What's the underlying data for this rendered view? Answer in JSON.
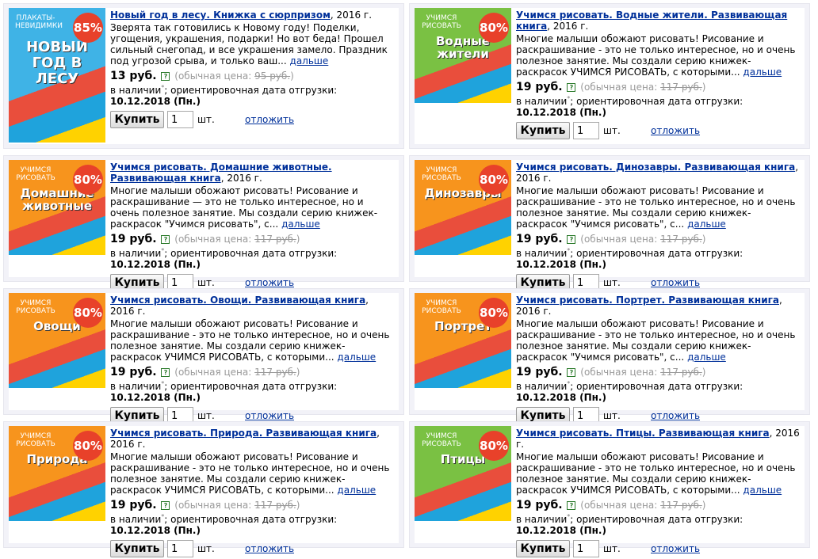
{
  "common": {
    "old_price_label": "(обычная цена:",
    "old_price_close": ")",
    "in_stock": "в наличии",
    "ship_label": "; ориентировочная дата отгрузки:",
    "ship_date": "10.12.2018 (Пн.)",
    "buy_label": "Купить",
    "qty_value": "1",
    "pcs_label": "шт.",
    "defer_label": "отложить",
    "more_label": "дальше",
    "year": ", 2016 г.",
    "help_glyph": "?"
  },
  "products": [
    {
      "title": "Новый год в лесу. Книжка с сюрпризом",
      "desc": "Зверята так готовились к Новому году! Поделки, угощения, украшения, подарки! Но вот беда! Прошел сильный снегопад, и все украшения замело. Праздник под угрозой срыва, и только ваш...",
      "price": "13 руб.",
      "old_price": "95 руб.",
      "badge": "85%",
      "cover_title": "НОВЫЙ ГОД В ЛЕСУ",
      "cover_top": "ПЛАКАТЫ-НЕВИДИМКИ",
      "cover_color": "#3fb3e6"
    },
    {
      "title": "Учимся рисовать. Водные жители. Развивающая книга",
      "desc": "Многие малыши обожают рисовать! Рисование и раскрашивание - это не только интересное, но и очень полезное занятие. Мы создали серию книжек-раскрасок УЧИМСЯ РИСОВАТЬ, с которыми...",
      "price": "19 руб.",
      "old_price": "117 руб.",
      "badge": "80%",
      "cover_title": "Водные жители",
      "cover_top": "УЧИМСЯ РИСОВАТЬ",
      "cover_color": "#7ac143"
    },
    {
      "title": "Учимся рисовать. Домашние животные. Развивающая книга",
      "desc": "Многие малыши обожают рисовать! Рисование и раскрашивание — это не только интересное, но и очень полезное занятие. Мы создали серию книжек-раскрасок \"Учимся рисовать\", с...",
      "price": "19 руб.",
      "old_price": "117 руб.",
      "badge": "80%",
      "cover_title": "Домашние животные",
      "cover_top": "УЧИМСЯ РИСОВАТЬ",
      "cover_color": "#f7941d"
    },
    {
      "title": "Учимся рисовать. Динозавры. Развивающая книга",
      "desc": "Многие малыши обожают рисовать! Рисование и раскрашивание - это не только интересное, но и очень полезное занятие. Мы создали серию книжек-раскрасок \"Учимся рисовать\", с...",
      "price": "19 руб.",
      "old_price": "117 руб.",
      "badge": "80%",
      "cover_title": "Динозавры",
      "cover_top": "УЧИМСЯ РИСОВАТЬ",
      "cover_color": "#f7941d"
    },
    {
      "title": "Учимся рисовать. Овощи. Развивающая книга",
      "desc": "Многие малыши обожают рисовать! Рисование и раскрашивание - это не только интересное, но и очень полезное занятие. Мы создали серию книжек-раскрасок УЧИМСЯ РИСОВАТЬ, с которыми...",
      "price": "19 руб.",
      "old_price": "117 руб.",
      "badge": "80%",
      "cover_title": "Овощи",
      "cover_top": "УЧИМСЯ РИСОВАТЬ",
      "cover_color": "#f7941d"
    },
    {
      "title": "Учимся рисовать. Портрет. Развивающая книга",
      "desc": "Многие малыши обожают рисовать! Рисование и раскрашивание - это не только интересное, но и очень полезное занятие. Мы создали серию книжек-раскрасок \"Учимся рисовать\", с...",
      "price": "19 руб.",
      "old_price": "117 руб.",
      "badge": "80%",
      "cover_title": "Портрет",
      "cover_top": "УЧИМСЯ РИСОВАТЬ",
      "cover_color": "#f7941d"
    },
    {
      "title": "Учимся рисовать. Природа. Развивающая книга",
      "desc": "Многие малыши обожают рисовать! Рисование и раскрашивание - это не только интересное, но и очень полезное занятие. Мы создали серию книжек-раскрасок УЧИМСЯ РИСОВАТЬ, с которыми...",
      "price": "19 руб.",
      "old_price": "117 руб.",
      "badge": "80%",
      "cover_title": "Природа",
      "cover_top": "УЧИМСЯ РИСОВАТЬ",
      "cover_color": "#f7941d"
    },
    {
      "title": "Учимся рисовать. Птицы. Развивающая книга",
      "desc": "Многие малыши обожают рисовать! Рисование и раскрашивание - это не только интересное, но и очень полезное занятие. Мы создали серию книжек-раскрасок УЧИМСЯ РИСОВАТЬ, с которыми...",
      "price": "19 руб.",
      "old_price": "117 руб.",
      "badge": "80%",
      "cover_title": "Птицы",
      "cover_top": "УЧИМСЯ РИСОВАТЬ",
      "cover_color": "#7ac143"
    }
  ]
}
